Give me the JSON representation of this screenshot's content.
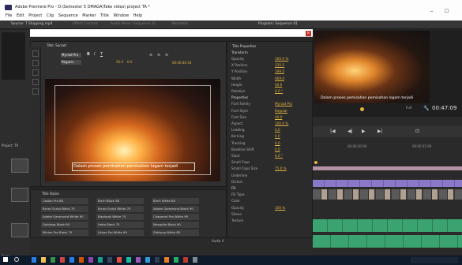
{
  "window": {
    "title": "Adobe Premiere Pro - D:\\Semester 5 DMAGA\\Take video\\ project TA *",
    "menu": [
      "File",
      "Edit",
      "Project",
      "Clip",
      "Sequence",
      "Marker",
      "Title",
      "Window",
      "Help"
    ]
  },
  "panel_tabs": {
    "source": "Source: T Shipping.mp4",
    "effect_controls": "Effect Controls",
    "audio_mixer": "Audio Mixer: Sequence 01",
    "metadata": "Metadata",
    "program": "Program: Sequence 01"
  },
  "titler": {
    "title_tab": "Title: Sunset",
    "properties_tab": "Title Properties",
    "styles_tab": "Title Styles",
    "font": "Myriad Pro",
    "style": "Regular",
    "size": "50.0",
    "kerning": "0.0",
    "timecode": "00:00:40:16",
    "caption": "Dalam proses pemisahan pemisahan logam terjadi"
  },
  "properties": {
    "transform_header": "Transform",
    "transform": [
      {
        "label": "Opacity",
        "value": "100.0 %"
      },
      {
        "label": "X Position",
        "value": "335.5"
      },
      {
        "label": "Y Position",
        "value": "299.5"
      },
      {
        "label": "Width",
        "value": "669.0"
      },
      {
        "label": "Height",
        "value": "40.0"
      },
      {
        "label": "Rotation",
        "value": "0.0 °"
      }
    ],
    "properties_header": "Properties",
    "font_family_label": "Font Family",
    "font_family_value": "Myriad Pro",
    "font_style_label": "Font Style",
    "font_style_value": "Regular",
    "props": [
      {
        "label": "Font Size",
        "value": "40.0"
      },
      {
        "label": "Aspect",
        "value": "100.0 %"
      },
      {
        "label": "Leading",
        "value": "0.0"
      },
      {
        "label": "Kerning",
        "value": "0.0"
      },
      {
        "label": "Tracking",
        "value": "0.0"
      },
      {
        "label": "Baseline Shift",
        "value": "0.0"
      },
      {
        "label": "Slant",
        "value": "0.0 °"
      },
      {
        "label": "Small Caps",
        "value": ""
      },
      {
        "label": "Small Caps Size",
        "value": "75.0 %"
      },
      {
        "label": "Underline",
        "value": ""
      },
      {
        "label": "Distort",
        "value": ""
      }
    ],
    "fill_header": "Fill",
    "fill_rows": [
      {
        "label": "Fill Type",
        "value": ""
      },
      {
        "label": "Color",
        "value": ""
      },
      {
        "label": "Opacity",
        "value": "100 %"
      },
      {
        "label": "Sheen",
        "value": ""
      },
      {
        "label": "Texture",
        "value": ""
      }
    ]
  },
  "styles": [
    [
      "Caslon Pro 68",
      "Birch Black 80",
      "Birch White 80"
    ],
    [
      "Brush Script Black 75",
      "Brush Script White 75",
      "Adobe Garamond Black 90"
    ],
    [
      "Adobe Garamond White 90",
      "Blackoak White 75",
      "Chaparral Pro White 90"
    ],
    [
      "Goldings Black 80",
      "Hobo Black 75",
      "Mesquite Black 90"
    ],
    [
      "Minion Pro Black 70",
      "Lithos Pro White 90",
      "Giddyup White 85"
    ]
  ],
  "program": {
    "caption": "Dalam proses pemisahan pemisahan logam terjadi",
    "fit": "Full",
    "timecode": "00:47:09"
  },
  "timeline": {
    "times": [
      "00:00:30:00",
      "00:00:35:00"
    ],
    "audio_label": "Audio 4"
  },
  "left_panel": {
    "project_label": "Project: TA",
    "items_label": "Items"
  },
  "colors": {
    "accent": "#e2b23d",
    "video_clip": "#8a79c9",
    "audio_clip": "#3ba36f",
    "close": "#c8322d"
  }
}
